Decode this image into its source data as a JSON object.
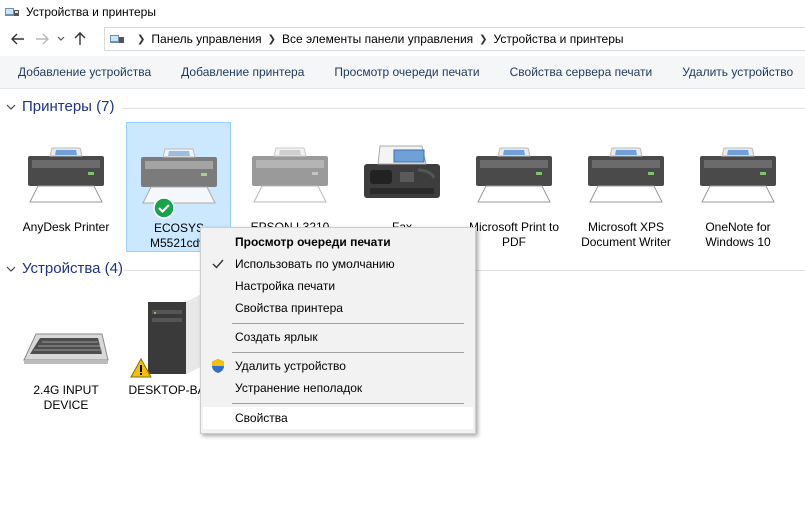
{
  "window": {
    "title": "Устройства и принтеры"
  },
  "breadcrumb": [
    "Панель управления",
    "Все элементы панели управления",
    "Устройства и принтеры"
  ],
  "toolbar": {
    "add_device": "Добавление устройства",
    "add_printer": "Добавление принтера",
    "view_queue": "Просмотр очереди печати",
    "server_props": "Свойства сервера печати",
    "remove_device": "Удалить устройство"
  },
  "groups": {
    "printers": {
      "label": "Принтеры (7)"
    },
    "devices": {
      "label": "Устройства (4)"
    }
  },
  "printers": [
    {
      "label": "AnyDesk Printer"
    },
    {
      "label": "ECOSYS M5521cdw"
    },
    {
      "label": "EPSON L3210"
    },
    {
      "label": "Fax"
    },
    {
      "label": "Microsoft Print to PDF"
    },
    {
      "label": "Microsoft XPS Document Writer"
    },
    {
      "label": "OneNote for Windows 10"
    }
  ],
  "devices": [
    {
      "label": "2.4G INPUT DEVICE"
    },
    {
      "label": "DESKTOP-BA TS"
    }
  ],
  "context_menu": {
    "view_queue": "Просмотр очереди печати",
    "set_default": "Использовать по умолчанию",
    "print_prefs": "Настройка печати",
    "printer_props": "Свойства принтера",
    "create_shortcut": "Создать ярлык",
    "remove_device": "Удалить устройство",
    "troubleshoot": "Устранение неполадок",
    "properties": "Свойства"
  },
  "colors": {
    "accent": "#1e3287",
    "selection_bg": "#cce8ff",
    "selection_border": "#99d1ff",
    "default_check": "#16a34a",
    "warning": "#f2c200"
  }
}
